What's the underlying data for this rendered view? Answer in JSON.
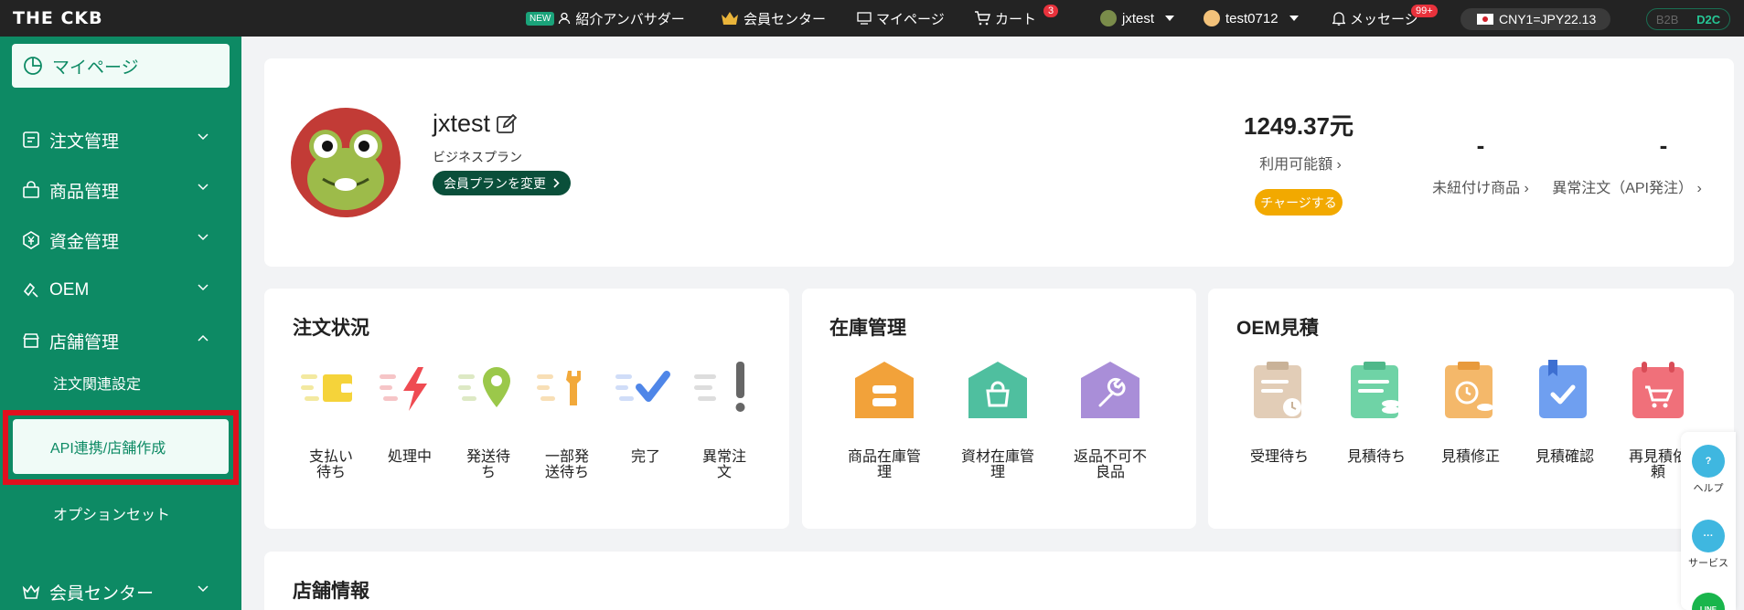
{
  "app": {
    "logo": "THE CKB"
  },
  "topbar": {
    "new_badge": "NEW",
    "ambassador": "紹介アンバサダー",
    "member_center": "会員センター",
    "mypage": "マイページ",
    "cart": "カート",
    "cart_count": "3",
    "user1": "jxtest",
    "user2": "test0712",
    "messages": "メッセージ",
    "messages_count": "99+",
    "rate": "CNY1=JPY22.13",
    "mode_b2b": "B2B",
    "mode_d2c": "D2C"
  },
  "sidebar": {
    "mypage": "マイページ",
    "items": [
      {
        "label": "注文管理",
        "icon": "order-icon"
      },
      {
        "label": "商品管理",
        "icon": "bag-icon"
      },
      {
        "label": "資金管理",
        "icon": "yen-icon"
      },
      {
        "label": "OEM",
        "icon": "oem-icon"
      },
      {
        "label": "店舗管理",
        "icon": "store-icon"
      }
    ],
    "sub_items": [
      "注文関連設定",
      "API連携/店舗作成",
      "オプションセット"
    ],
    "member_center": "会員センター"
  },
  "profile": {
    "username": "jxtest",
    "plan": "ビジネスプラン",
    "change_plan": "会員プランを変更",
    "balance": "1249.37元",
    "balance_label": "利用可能額",
    "charge": "チャージする",
    "unlinked_value": "-",
    "unlinked_label": "未紐付け商品",
    "abnormal_value": "-",
    "abnormal_label": "異常注文（API発注）"
  },
  "order_status": {
    "title": "注文状況",
    "tiles": [
      {
        "line1": "支払い",
        "line2": "待ち",
        "color": "#f5d33a"
      },
      {
        "line1": "処理中",
        "line2": "",
        "color": "#ef4b52"
      },
      {
        "line1": "発送待",
        "line2": "ち",
        "color": "#9bc84a"
      },
      {
        "line1": "一部発",
        "line2": "送待ち",
        "color": "#f2a93b"
      },
      {
        "line1": "完了",
        "line2": "",
        "color": "#4f86e8"
      },
      {
        "line1": "異常注",
        "line2": "文",
        "color": "#666666"
      }
    ]
  },
  "inventory": {
    "title": "在庫管理",
    "tiles": [
      {
        "line1": "商品在庫管",
        "line2": "理",
        "color": "#f2a23a"
      },
      {
        "line1": "資材在庫管",
        "line2": "理",
        "color": "#4fbf9f"
      },
      {
        "line1": "返品不可不",
        "line2": "良品",
        "color": "#a98ed8"
      }
    ]
  },
  "oem_quote": {
    "title": "OEM見積",
    "tiles": [
      {
        "line1": "受理待ち",
        "line2": "",
        "color": "#e2cdb7"
      },
      {
        "line1": "見積待ち",
        "line2": "",
        "color": "#6fd3a6"
      },
      {
        "line1": "見積修正",
        "line2": "",
        "color": "#f4b86a"
      },
      {
        "line1": "見積確認",
        "line2": "",
        "color": "#6f9ff0"
      },
      {
        "line1": "再見積依",
        "line2": "頼",
        "color": "#f0707a"
      }
    ]
  },
  "store_info": {
    "title": "店舗情報"
  },
  "float": {
    "help": "ヘルプ",
    "service": "サービス",
    "line": "LINE"
  }
}
